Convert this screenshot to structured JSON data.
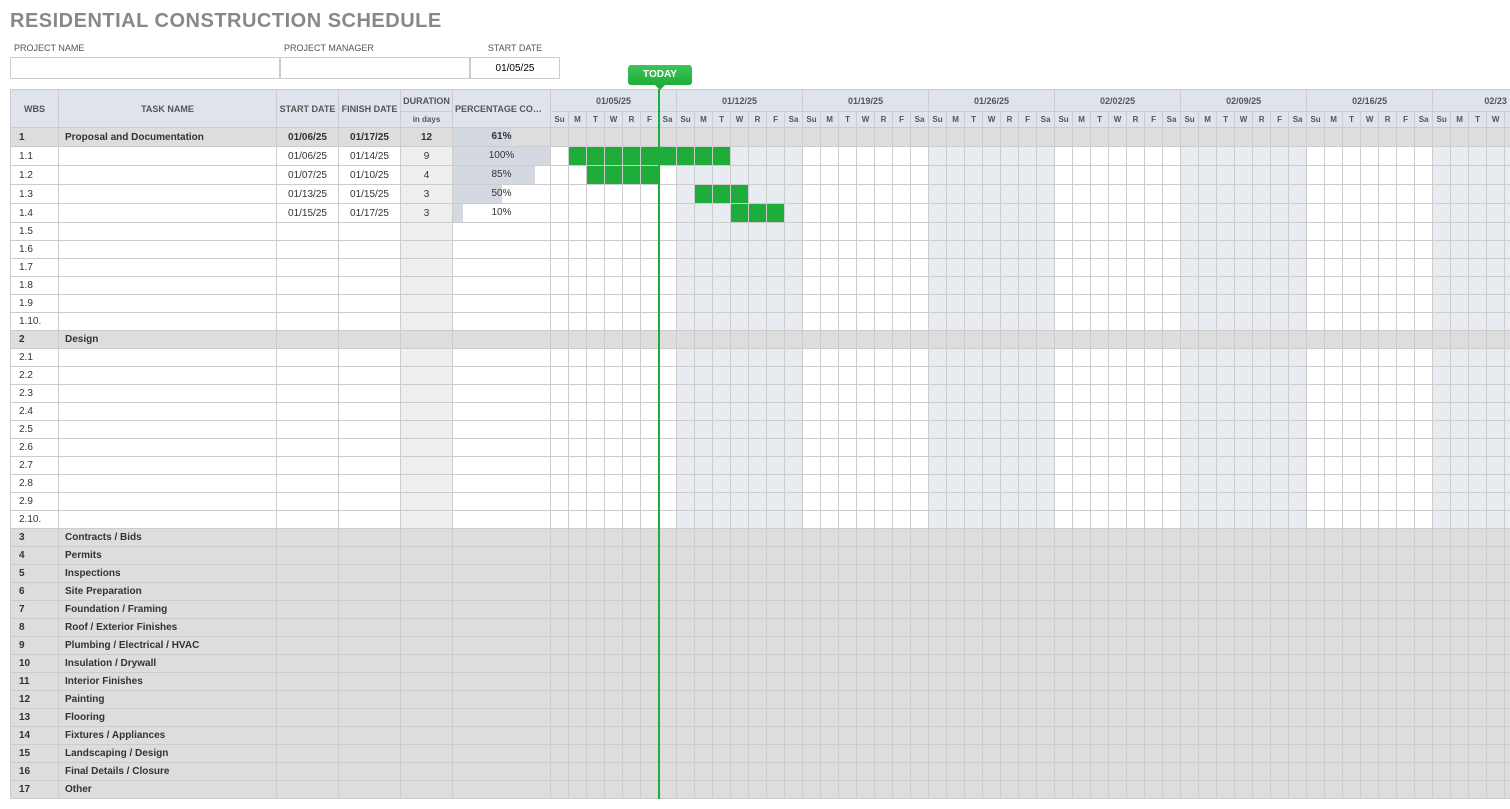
{
  "title": "RESIDENTIAL CONSTRUCTION SCHEDULE",
  "header": {
    "project_name_label": "PROJECT NAME",
    "project_name": "",
    "project_manager_label": "PROJECT MANAGER",
    "project_manager": "",
    "start_date_label": "START DATE",
    "start_date": "01/05/25"
  },
  "today_label": "TODAY",
  "cols": {
    "wbs": "WBS",
    "task": "TASK NAME",
    "start": "START DATE",
    "finish": "FINISH DATE",
    "duration": "DURATION",
    "duration_sub": "in days",
    "pct": "PERCENTAGE COMPLETE"
  },
  "weeks": [
    "01/05/25",
    "01/12/25",
    "01/19/25",
    "01/26/25",
    "02/02/25",
    "02/09/25",
    "02/16/25",
    "02/23"
  ],
  "days": [
    "Su",
    "M",
    "T",
    "W",
    "R",
    "F",
    "Sa"
  ],
  "rows": [
    {
      "wbs": "1",
      "task": "Proposal and Documentation",
      "start": "01/06/25",
      "finish": "01/17/25",
      "dur": "12",
      "pct": "61%",
      "pctw": 61,
      "phase": true,
      "bars": []
    },
    {
      "wbs": "1.1",
      "task": "",
      "start": "01/06/25",
      "finish": "01/14/25",
      "dur": "9",
      "pct": "100%",
      "pctw": 100,
      "bars": [
        1,
        2,
        3,
        4,
        5,
        6,
        7,
        8,
        9
      ]
    },
    {
      "wbs": "1.2",
      "task": "",
      "start": "01/07/25",
      "finish": "01/10/25",
      "dur": "4",
      "pct": "85%",
      "pctw": 85,
      "bars": [
        2,
        3,
        4,
        5
      ]
    },
    {
      "wbs": "1.3",
      "task": "",
      "start": "01/13/25",
      "finish": "01/15/25",
      "dur": "3",
      "pct": "50%",
      "pctw": 50,
      "bars": [
        8,
        9,
        10
      ]
    },
    {
      "wbs": "1.4",
      "task": "",
      "start": "01/15/25",
      "finish": "01/17/25",
      "dur": "3",
      "pct": "10%",
      "pctw": 10,
      "bars": [
        10,
        11,
        12
      ]
    },
    {
      "wbs": "1.5"
    },
    {
      "wbs": "1.6"
    },
    {
      "wbs": "1.7"
    },
    {
      "wbs": "1.8"
    },
    {
      "wbs": "1.9"
    },
    {
      "wbs": "1.10."
    },
    {
      "wbs": "2",
      "task": "Design",
      "phase": true
    },
    {
      "wbs": "2.1"
    },
    {
      "wbs": "2.2"
    },
    {
      "wbs": "2.3"
    },
    {
      "wbs": "2.4"
    },
    {
      "wbs": "2.5"
    },
    {
      "wbs": "2.6"
    },
    {
      "wbs": "2.7"
    },
    {
      "wbs": "2.8"
    },
    {
      "wbs": "2.9"
    },
    {
      "wbs": "2.10."
    },
    {
      "wbs": "3",
      "task": "Contracts / Bids",
      "phase": true
    },
    {
      "wbs": "4",
      "task": "Permits",
      "phase": true
    },
    {
      "wbs": "5",
      "task": "Inspections",
      "phase": true
    },
    {
      "wbs": "6",
      "task": "Site Preparation",
      "phase": true
    },
    {
      "wbs": "7",
      "task": "Foundation / Framing",
      "phase": true
    },
    {
      "wbs": "8",
      "task": "Roof / Exterior Finishes",
      "phase": true
    },
    {
      "wbs": "9",
      "task": "Plumbing / Electrical / HVAC",
      "phase": true
    },
    {
      "wbs": "10",
      "task": "Insulation / Drywall",
      "phase": true
    },
    {
      "wbs": "11",
      "task": "Interior Finishes",
      "phase": true
    },
    {
      "wbs": "12",
      "task": "Painting",
      "phase": true
    },
    {
      "wbs": "13",
      "task": "Flooring",
      "phase": true
    },
    {
      "wbs": "14",
      "task": "Fixtures / Appliances",
      "phase": true
    },
    {
      "wbs": "15",
      "task": "Landscaping / Design",
      "phase": true
    },
    {
      "wbs": "16",
      "task": "Final Details / Closure",
      "phase": true
    },
    {
      "wbs": "17",
      "task": "Other",
      "phase": true
    }
  ],
  "today_col": 5,
  "shaded_weeks": [
    1,
    3,
    5,
    7
  ]
}
